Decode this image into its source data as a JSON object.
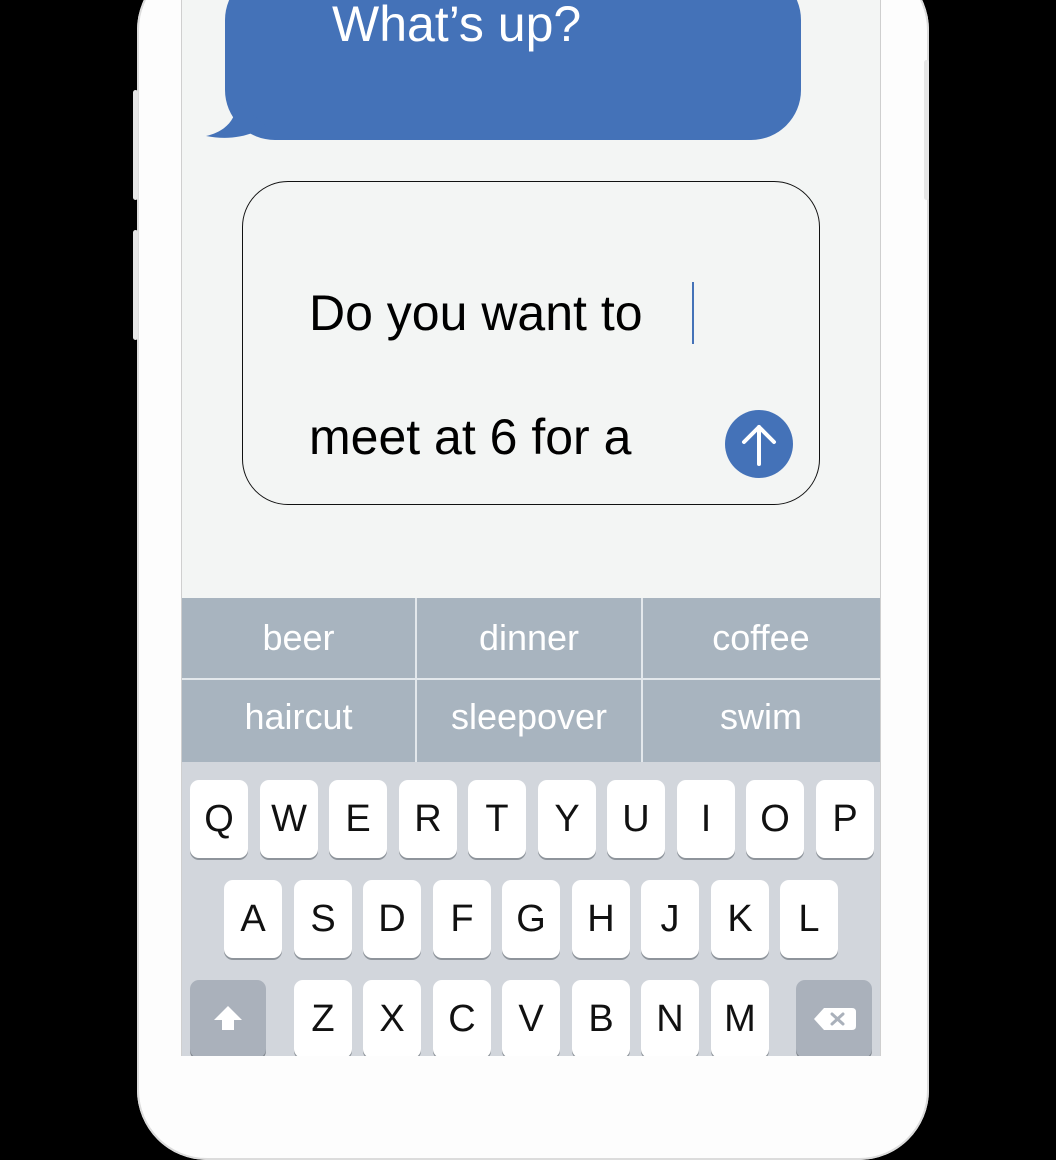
{
  "conversation": {
    "received_message": "What’s up?",
    "draft_line1": "Do you want to",
    "draft_line2": "meet  at 6 for a"
  },
  "suggestions": [
    [
      "beer",
      "dinner",
      "coffee"
    ],
    [
      "haircut",
      "sleepover",
      "swim"
    ]
  ],
  "keyboard": {
    "row1": [
      "Q",
      "W",
      "E",
      "R",
      "T",
      "Y",
      "U",
      "I",
      "O",
      "P"
    ],
    "row2": [
      "A",
      "S",
      "D",
      "F",
      "G",
      "H",
      "J",
      "K",
      "L"
    ],
    "row3": [
      "Z",
      "X",
      "C",
      "V",
      "B",
      "N",
      "M"
    ]
  },
  "icons": {
    "send": "arrow-up-icon",
    "shift": "shift-icon",
    "backspace": "backspace-icon"
  },
  "colors": {
    "accent": "#4472b8",
    "suggestion_bar": "#a8b4bf",
    "keyboard_bg": "#d2d6dc"
  }
}
